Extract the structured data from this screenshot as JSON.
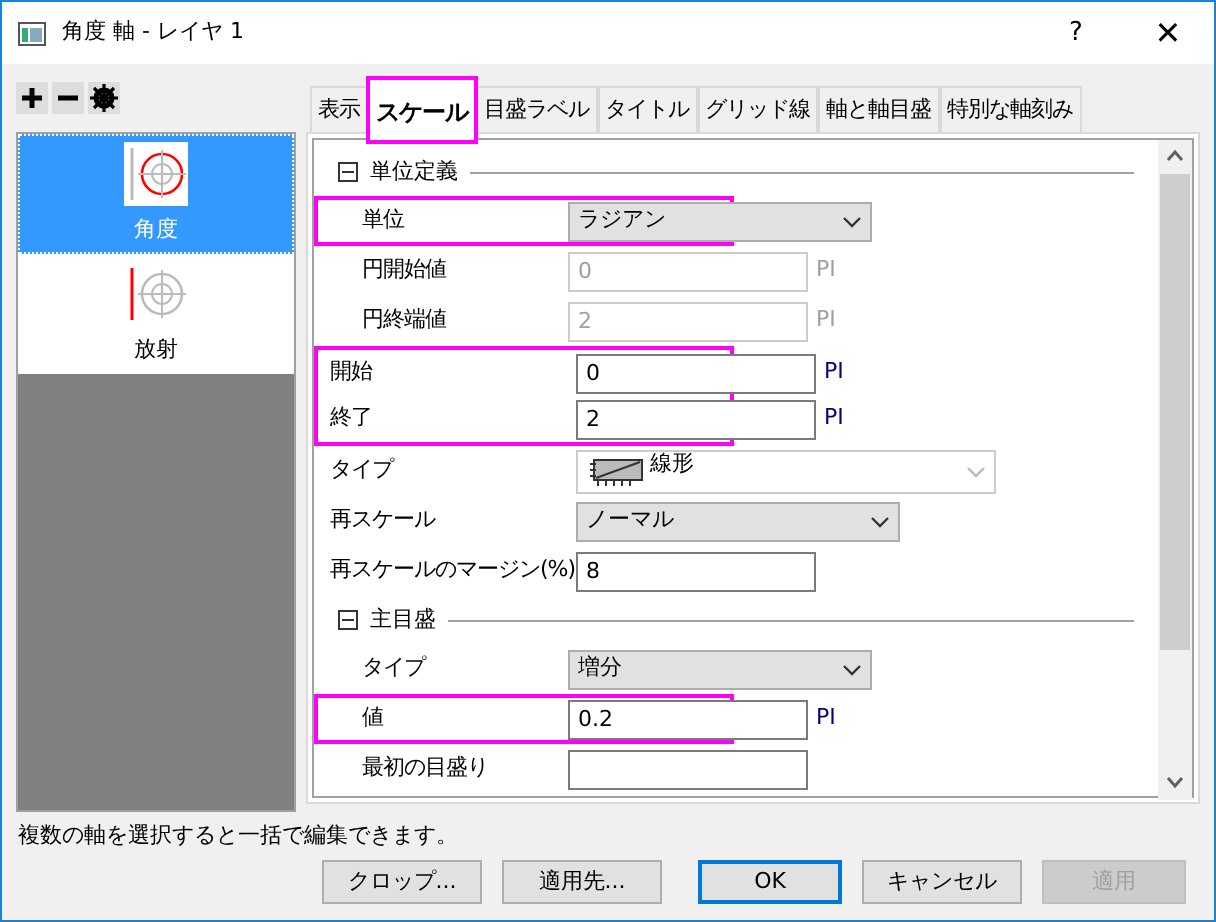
{
  "window": {
    "title": "角度 軸 - レイヤ 1",
    "help": "?",
    "close": "✕"
  },
  "axes": [
    {
      "label": "角度",
      "selected": true,
      "kind": "angle"
    },
    {
      "label": "放射",
      "selected": false,
      "kind": "radial"
    }
  ],
  "tabs": [
    {
      "label": "表示",
      "selected": false,
      "highlighted": false
    },
    {
      "label": "スケール",
      "selected": true,
      "highlighted": true
    },
    {
      "label": "目盛ラベル",
      "selected": false,
      "highlighted": false
    },
    {
      "label": "タイトル",
      "selected": false,
      "highlighted": false
    },
    {
      "label": "グリッド線",
      "selected": false,
      "highlighted": false
    },
    {
      "label": "軸と軸目盛",
      "selected": false,
      "highlighted": false
    },
    {
      "label": "特別な軸刻み",
      "selected": false,
      "highlighted": false
    }
  ],
  "rows": [
    {
      "kind": "section",
      "label": "単位定義",
      "expanded": true,
      "children": [
        {
          "kind": "select",
          "label": "単位",
          "value": "ラジアン",
          "highlighted": true,
          "disabled": false
        },
        {
          "kind": "input",
          "label": "円開始値",
          "value": "0",
          "unit": "PI",
          "highlighted": false,
          "disabled": true
        },
        {
          "kind": "input",
          "label": "円終端値",
          "value": "2",
          "unit": "PI",
          "highlighted": false,
          "disabled": true
        }
      ]
    },
    {
      "kind": "input",
      "label": "開始",
      "value": "0",
      "unit": "PI",
      "highlighted": true,
      "disabled": false
    },
    {
      "kind": "input",
      "label": "終了",
      "value": "2",
      "unit": "PI",
      "highlighted": true,
      "disabled": false
    },
    {
      "kind": "combo",
      "label": "タイプ",
      "value": "線形",
      "highlighted": false,
      "disabled": true
    },
    {
      "kind": "select",
      "label": "再スケール",
      "value": "ノーマル",
      "highlighted": false,
      "disabled": false
    },
    {
      "kind": "input",
      "label": "再スケールのマージン(%)",
      "value": "8",
      "highlighted": false,
      "disabled": false
    },
    {
      "kind": "section",
      "label": "主目盛",
      "expanded": true,
      "children": [
        {
          "kind": "select",
          "label": "タイプ",
          "value": "増分",
          "highlighted": false,
          "disabled": false
        },
        {
          "kind": "input",
          "label": "値",
          "value": "0.2",
          "unit": "PI",
          "highlighted": true,
          "disabled": false
        },
        {
          "kind": "input",
          "label": "最初の目盛り",
          "highlighted": false,
          "disabled": false
        }
      ]
    }
  ],
  "status": "複数の軸を選択すると一括で編集できます。",
  "buttons": [
    {
      "label": "クロップ...",
      "kind": "normal"
    },
    {
      "label": "適用先...",
      "kind": "normal"
    },
    {
      "label": "OK",
      "kind": "default"
    },
    {
      "label": "キャンセル",
      "kind": "normal"
    },
    {
      "label": "適用",
      "kind": "disabled"
    }
  ]
}
